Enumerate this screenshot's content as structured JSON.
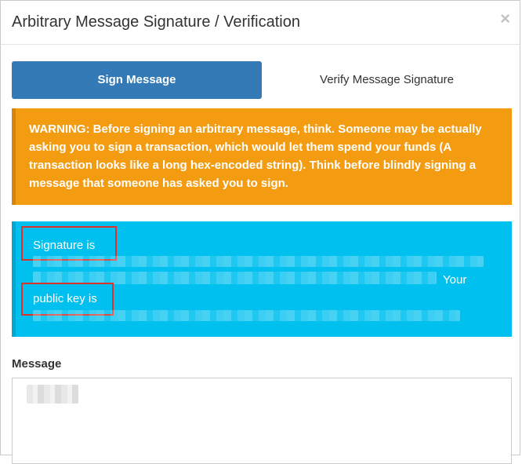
{
  "modal": {
    "title": "Arbitrary Message Signature / Verification",
    "close_glyph": "×"
  },
  "tabs": [
    {
      "label": "Sign Message",
      "active": true
    },
    {
      "label": "Verify Message Signature",
      "active": false
    }
  ],
  "warning": {
    "text": "WARNING: Before signing an arbitrary message, think. Someone may be actually asking you to sign a transaction, which would let them spend your funds (A transaction looks like a long hex-encoded string). Think before blindly signing a message that someone has asked you to sign."
  },
  "result": {
    "signature_label": "Signature is",
    "your_label": "Your",
    "public_key_label": "public key is"
  },
  "message": {
    "label": "Message"
  },
  "colors": {
    "primary": "#337ab7",
    "warning": "#f39c12",
    "info": "#00c0ef",
    "highlight": "#d9342b"
  }
}
